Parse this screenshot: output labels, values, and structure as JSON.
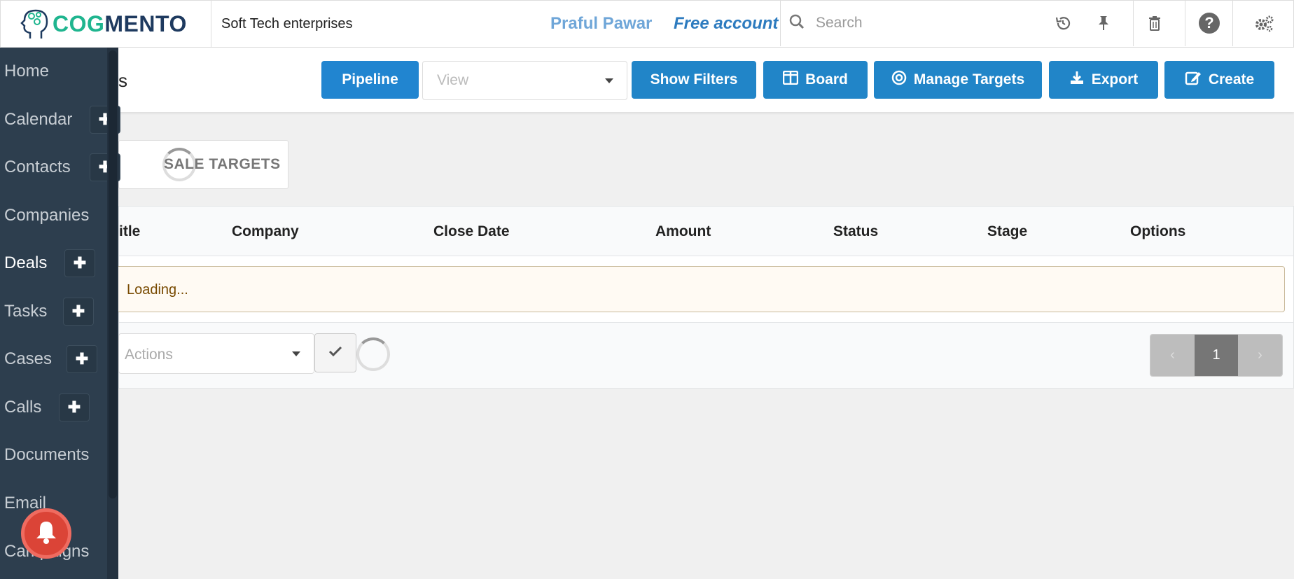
{
  "topbar": {
    "logo_part1": "COG",
    "logo_part2": "MENTO",
    "company": "Soft Tech enterprises",
    "user_name": "Praful Pawar",
    "account_type": "Free account",
    "search_placeholder": "Search",
    "icons": [
      "history-icon",
      "pin-icon",
      "trash-icon",
      "help-icon",
      "settings-icon"
    ]
  },
  "sidebar": {
    "items": [
      {
        "label": "Home",
        "has_add": false
      },
      {
        "label": "Calendar",
        "has_add": true
      },
      {
        "label": "Contacts",
        "has_add": true
      },
      {
        "label": "Companies",
        "has_add": false
      },
      {
        "label": "Deals",
        "has_add": true,
        "active": true
      },
      {
        "label": "Tasks",
        "has_add": true
      },
      {
        "label": "Cases",
        "has_add": true
      },
      {
        "label": "Calls",
        "has_add": true
      },
      {
        "label": "Documents",
        "has_add": false
      },
      {
        "label": "Email",
        "has_add": false
      },
      {
        "label": "Campaigns",
        "has_add": false
      }
    ],
    "add_symbol": "✚"
  },
  "header": {
    "title_fragment": "s",
    "pipeline_label": "Pipeline",
    "view_placeholder": "View",
    "show_filters_label": "Show Filters",
    "board_label": "Board",
    "manage_targets_label": "Manage Targets",
    "export_label": "Export",
    "create_label": "Create"
  },
  "targets": {
    "label": "SALE TARGETS"
  },
  "table": {
    "columns": [
      "itle",
      "Company",
      "Close Date",
      "Amount",
      "Status",
      "Stage",
      "Options"
    ],
    "loading_text": "Loading...",
    "actions_placeholder": "Actions"
  },
  "pagination": {
    "prev": "‹",
    "current": "1",
    "next": "›"
  },
  "colors": {
    "primary_button": "#2185c8",
    "sidebar_bg": "#2d3e4e",
    "logo_green": "#1fb58f",
    "logo_navy": "#1e3a5f",
    "notification_red": "#db4437"
  }
}
